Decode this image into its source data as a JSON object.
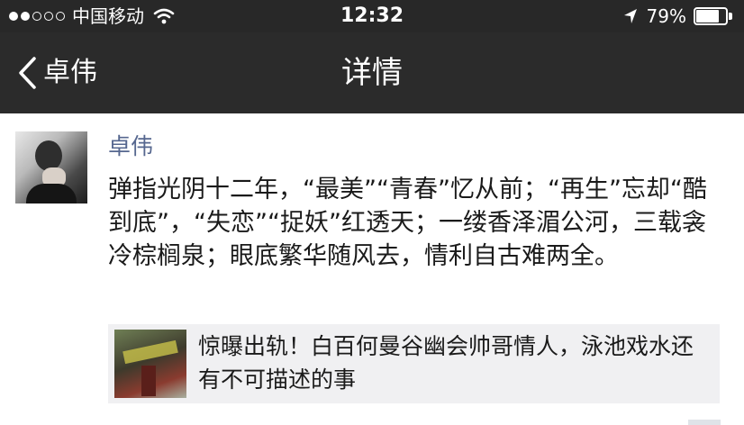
{
  "status_bar": {
    "carrier": "中国移动",
    "time": "12:32",
    "battery_percent": "79%",
    "battery_level": 0.79,
    "signal_dots_filled": 2,
    "signal_dots_total": 5
  },
  "nav": {
    "back_label": "卓伟",
    "title": "详情"
  },
  "post": {
    "author": "卓伟",
    "text": "弹指光阴十二年，“最美”“青春”忆从前；“再生”忘却“酷到底”，“失恋”“捉妖”红透天；一缕香泽湄公河，三载衾冷棕榈泉；眼底繁华随风去，情利自古难两全。",
    "link": {
      "title": "惊曝出轨！白百何曼谷幽会帅哥情人，泳池戏水还有不可描述的事"
    }
  },
  "colors": {
    "status_bar_bg": "#282828",
    "nav_bar_bg": "#2b2b2b",
    "author_name": "#56678f",
    "link_card_bg": "#f0f0f2"
  },
  "icons": {
    "wifi": "wifi-icon",
    "location": "location-arrow-icon",
    "battery": "battery-icon",
    "back": "chevron-left-icon"
  }
}
